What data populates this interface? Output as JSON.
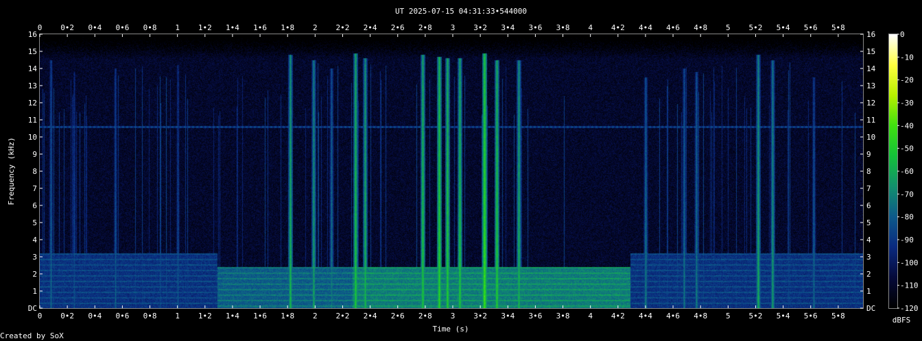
{
  "chart_data": {
    "type": "heatmap",
    "title": "UT 2025-07-15 04:31:33•544000",
    "xlabel": "Time (s)",
    "ylabel": "Frequency (kHz)",
    "xlim": [
      0,
      5.98
    ],
    "ylim": [
      0,
      16
    ],
    "x_ticks": [
      "0",
      "0•2",
      "0•4",
      "0•6",
      "0•8",
      "1",
      "1•2",
      "1•4",
      "1•6",
      "1•8",
      "2",
      "2•2",
      "2•4",
      "2•6",
      "2•8",
      "3",
      "3•2",
      "3•4",
      "3•6",
      "3•8",
      "4",
      "4•2",
      "4•4",
      "4•6",
      "4•8",
      "5",
      "5•2",
      "5•4",
      "5•6",
      "5•8"
    ],
    "x_tick_values": [
      0,
      0.2,
      0.4,
      0.6,
      0.8,
      1.0,
      1.2,
      1.4,
      1.6,
      1.8,
      2.0,
      2.2,
      2.4,
      2.6,
      2.8,
      3.0,
      3.2,
      3.4,
      3.6,
      3.8,
      4.0,
      4.2,
      4.4,
      4.6,
      4.8,
      5.0,
      5.2,
      5.4,
      5.6,
      5.8
    ],
    "y_ticks": [
      "DC",
      "1",
      "2",
      "3",
      "4",
      "5",
      "6",
      "7",
      "8",
      "9",
      "10",
      "11",
      "12",
      "13",
      "14",
      "15",
      "16"
    ],
    "y_tick_values": [
      0,
      1,
      2,
      3,
      4,
      5,
      6,
      7,
      8,
      9,
      10,
      11,
      12,
      13,
      14,
      15,
      16
    ],
    "colorbar": {
      "label": "dBFS",
      "range": [
        -120,
        0
      ],
      "ticks": [
        "0",
        "-10",
        "-20",
        "-30",
        "-40",
        "-50",
        "-60",
        "-70",
        "-80",
        "-90",
        "-100",
        "-110",
        "-120"
      ],
      "tick_values": [
        0,
        -10,
        -20,
        -30,
        -40,
        -50,
        -60,
        -70,
        -80,
        -90,
        -100,
        -110,
        -120
      ],
      "colors": [
        "#000000",
        "#050a3a",
        "#0a2a80",
        "#0d5a8a",
        "#12906e",
        "#14c23a",
        "#40e010",
        "#b8f000",
        "#ffff40",
        "#ffffff"
      ]
    },
    "background_db": -110,
    "hum_line": {
      "freq_khz": 10.6,
      "db": -85
    },
    "low_bands": [
      {
        "t_start": 0.0,
        "t_end": 1.29,
        "f_max_khz": 3.2,
        "db": -92
      },
      {
        "t_start": 1.29,
        "t_end": 2.27,
        "f_max_khz": 2.4,
        "db": -80
      },
      {
        "t_start": 2.27,
        "t_end": 4.29,
        "f_max_khz": 2.4,
        "db": -72
      },
      {
        "t_start": 4.29,
        "t_end": 5.98,
        "f_max_khz": 3.2,
        "db": -92
      }
    ],
    "transients": [
      {
        "t": 0.08,
        "f_max_khz": 14.5,
        "db": -75
      },
      {
        "t": 0.25,
        "f_max_khz": 13.8,
        "db": -82
      },
      {
        "t": 0.55,
        "f_max_khz": 14.0,
        "db": -78
      },
      {
        "t": 1.0,
        "f_max_khz": 14.2,
        "db": -80
      },
      {
        "t": 1.82,
        "f_max_khz": 14.8,
        "db": -55
      },
      {
        "t": 1.99,
        "f_max_khz": 14.5,
        "db": -60
      },
      {
        "t": 2.12,
        "f_max_khz": 14.0,
        "db": -70
      },
      {
        "t": 2.29,
        "f_max_khz": 14.9,
        "db": -50
      },
      {
        "t": 2.36,
        "f_max_khz": 14.6,
        "db": -55
      },
      {
        "t": 2.78,
        "f_max_khz": 14.8,
        "db": -50
      },
      {
        "t": 2.9,
        "f_max_khz": 14.7,
        "db": -45
      },
      {
        "t": 2.96,
        "f_max_khz": 14.6,
        "db": -48
      },
      {
        "t": 3.05,
        "f_max_khz": 14.6,
        "db": -50
      },
      {
        "t": 3.23,
        "f_max_khz": 14.9,
        "db": -40
      },
      {
        "t": 3.32,
        "f_max_khz": 14.5,
        "db": -48
      },
      {
        "t": 3.48,
        "f_max_khz": 14.5,
        "db": -55
      },
      {
        "t": 4.4,
        "f_max_khz": 13.5,
        "db": -70
      },
      {
        "t": 4.68,
        "f_max_khz": 14.0,
        "db": -72
      },
      {
        "t": 4.77,
        "f_max_khz": 13.8,
        "db": -70
      },
      {
        "t": 5.22,
        "f_max_khz": 14.8,
        "db": -58
      },
      {
        "t": 5.32,
        "f_max_khz": 14.5,
        "db": -62
      },
      {
        "t": 5.62,
        "f_max_khz": 13.5,
        "db": -75
      }
    ]
  },
  "footer": {
    "credit": "Created by SoX"
  }
}
